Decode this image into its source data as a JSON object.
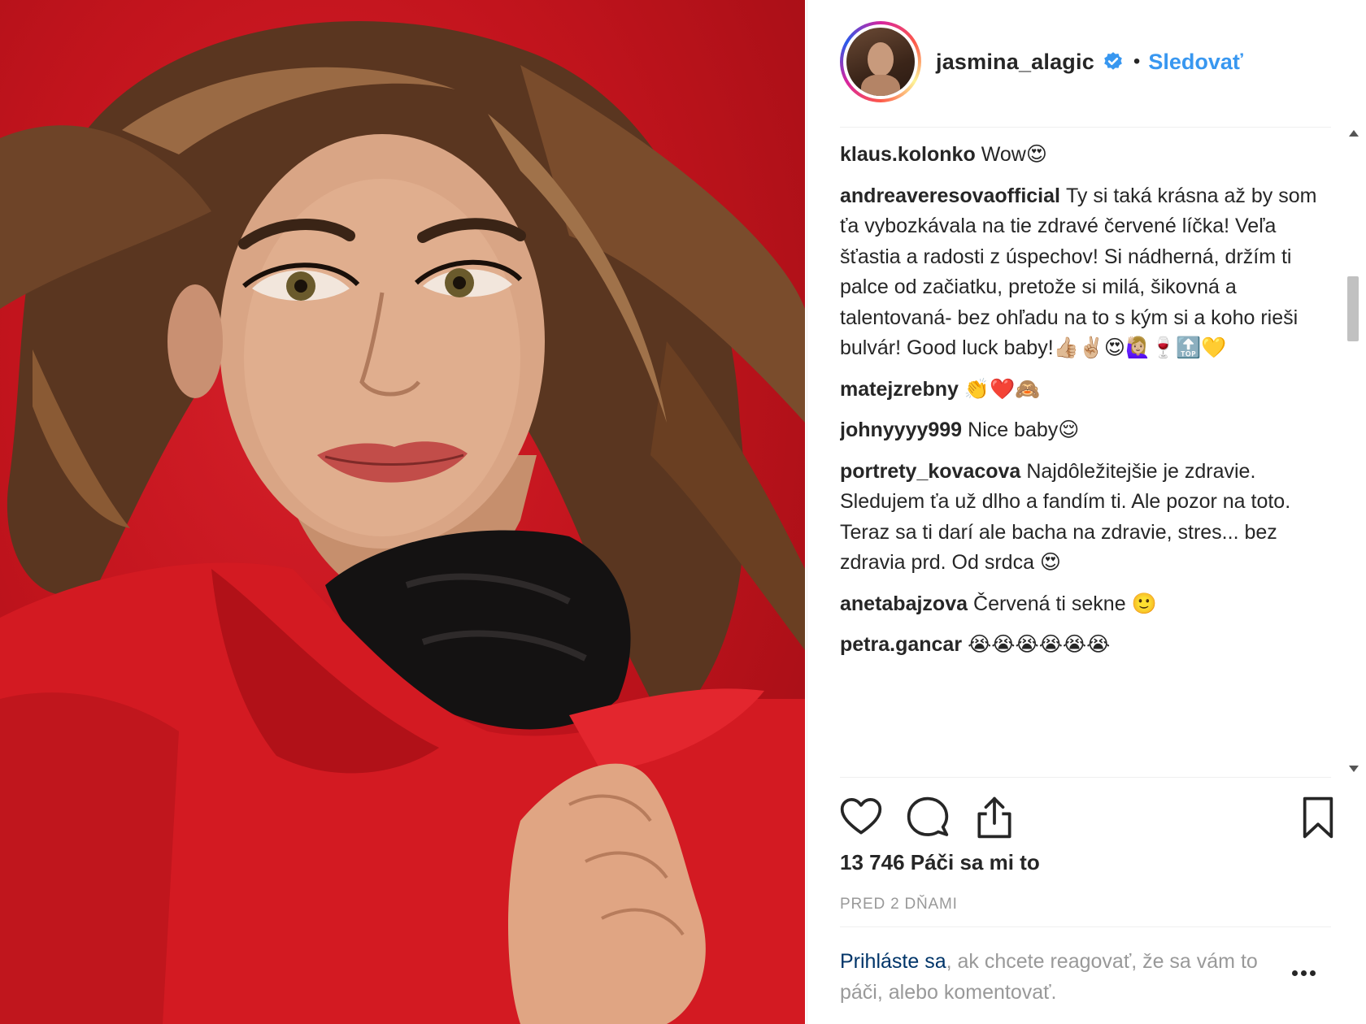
{
  "photo": {
    "alt_icon": "portrait-photo"
  },
  "header": {
    "username": "jasmina_alagic",
    "separator": "•",
    "follow_label": "Sledovať"
  },
  "comments": [
    {
      "user": "klaus.kolonko",
      "text": "Wow😍"
    },
    {
      "user": "andreaveresovaofficial",
      "text": "Ty si taká krásna až by som ťa vybozkávala na tie zdravé červené líčka! Veľa šťastia a radosti z úspechov! Si nádherná, držím ti palce od začiatku, pretože si milá, šikovná a talentovaná- bez ohľadu na to s kým si a koho rieši bulvár! Good luck baby!👍🏼✌🏼😍🙋🏼‍♀️🍷🔝💛"
    },
    {
      "user": "matejzrebny",
      "text": "👏❤️🙈"
    },
    {
      "user": "johnyyyy999",
      "text": "Nice baby😌"
    },
    {
      "user": "portrety_kovacova",
      "text": "Najdôležitejšie je zdravie. Sledujem ťa už dlho a fandím ti. Ale pozor na toto. Teraz sa ti darí ale bacha na zdravie, stres... bez zdravia prd. Od srdca 😍"
    },
    {
      "user": "anetabajzova",
      "text": "Červená ti sekne 🙂"
    },
    {
      "user": "petra.gancar",
      "text": "😭😭😭😭😭😭"
    }
  ],
  "stats": {
    "likes": "13 746 Páči sa mi to",
    "time": "PRED 2 DŇAMI"
  },
  "login": {
    "link_text": "Prihláste sa",
    "rest_text": ", ak chcete reagovať, že sa vám to páči, alebo komentovať."
  },
  "colors": {
    "accent": "#3897f0",
    "background_red": "#c2141d",
    "muted": "#999999"
  }
}
